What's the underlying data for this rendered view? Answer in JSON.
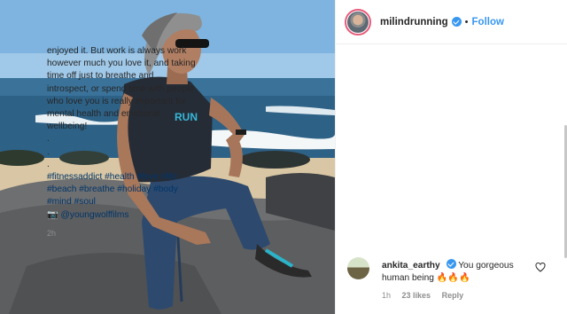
{
  "post": {
    "username": "milindrunning",
    "separator": "•",
    "follow_label": "Follow"
  },
  "caption": {
    "lines": [
      "enjoyed it. But work is always work",
      "however much you love it, and taking",
      "time off just to breathe and",
      "introspect, or spend time with people",
      "who love you is really important for",
      "mental health and emotional",
      "wellbeing!"
    ],
    "dots": [
      ".",
      ".",
      "."
    ],
    "hashtag_lines": [
      "#fitnessaddict #health #love #life",
      "#beach #breathe #holiday #body",
      "#mind #soul"
    ],
    "credit": "📷 @youngwolffilms",
    "time": "2h"
  },
  "comment": {
    "username": "ankita_earthy",
    "text": "You gorgeous",
    "text_line2": "human being 🔥🔥🔥",
    "time": "1h",
    "likes": "23 likes",
    "reply_label": "Reply"
  },
  "photo": {
    "shirt_text": "RUN"
  },
  "colors": {
    "link": "#3897f0",
    "hashtag": "#003569",
    "muted": "#8e8e8e"
  }
}
